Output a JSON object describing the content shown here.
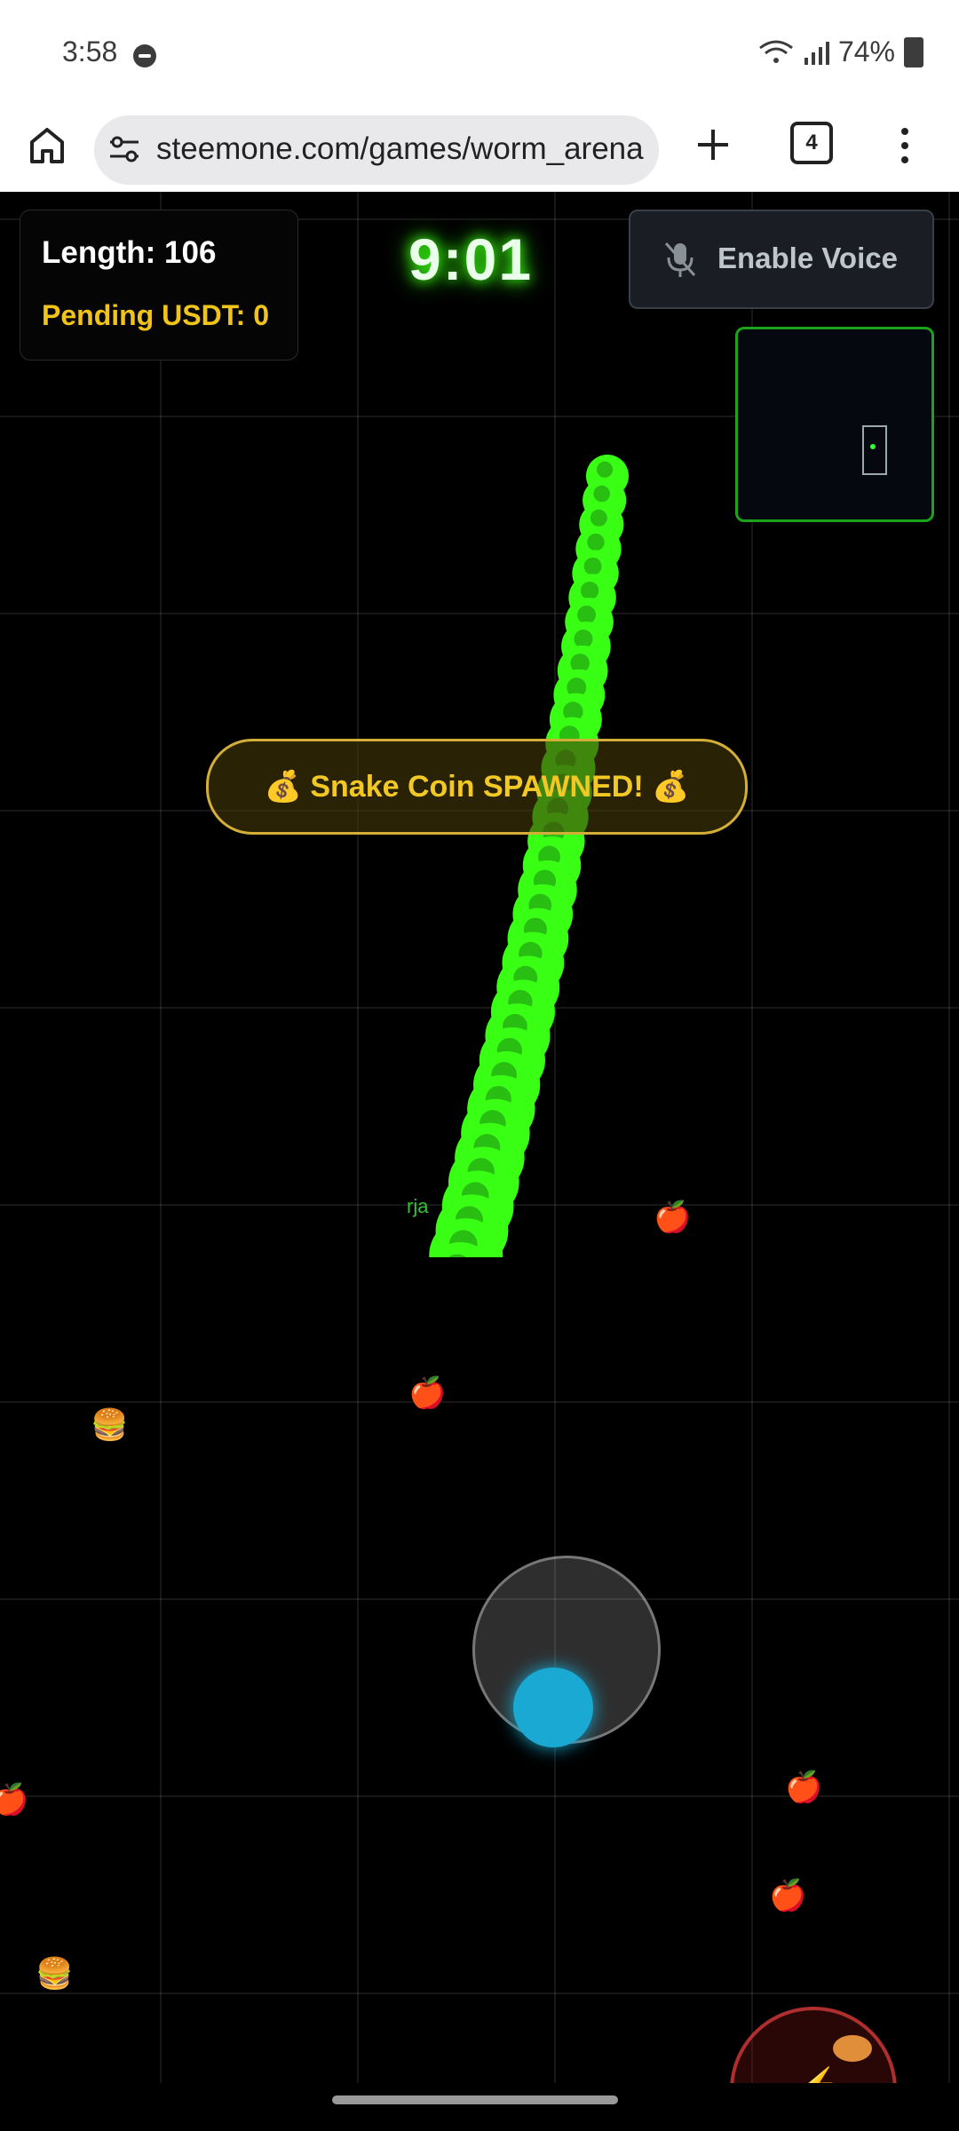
{
  "status_bar": {
    "time": "3:58",
    "battery": "74%"
  },
  "browser": {
    "url": "steemone.com/games/worm_arena",
    "tab_count": "4"
  },
  "hud": {
    "length_text": "Length: 106",
    "pending_text": "Pending USDT: 0",
    "timer": "9:01",
    "voice_button": "Enable Voice"
  },
  "banner": {
    "text": "💰 Snake Coin SPAWNED! 💰"
  },
  "player": {
    "name": "rja"
  },
  "food_icons": {
    "apple": "🍎",
    "burger": "🍔"
  },
  "colors": {
    "snake": "#39ff14",
    "accent_gold": "#f0c419",
    "joystick_knob": "#19a9d2",
    "minimap_border": "#1ba31b"
  },
  "icons": [
    "home-icon",
    "tune-icon",
    "plus-icon",
    "tabs-icon",
    "menu-icon",
    "mic-off-icon",
    "dnd-icon",
    "wifi-icon",
    "signal-icon",
    "battery-icon"
  ]
}
